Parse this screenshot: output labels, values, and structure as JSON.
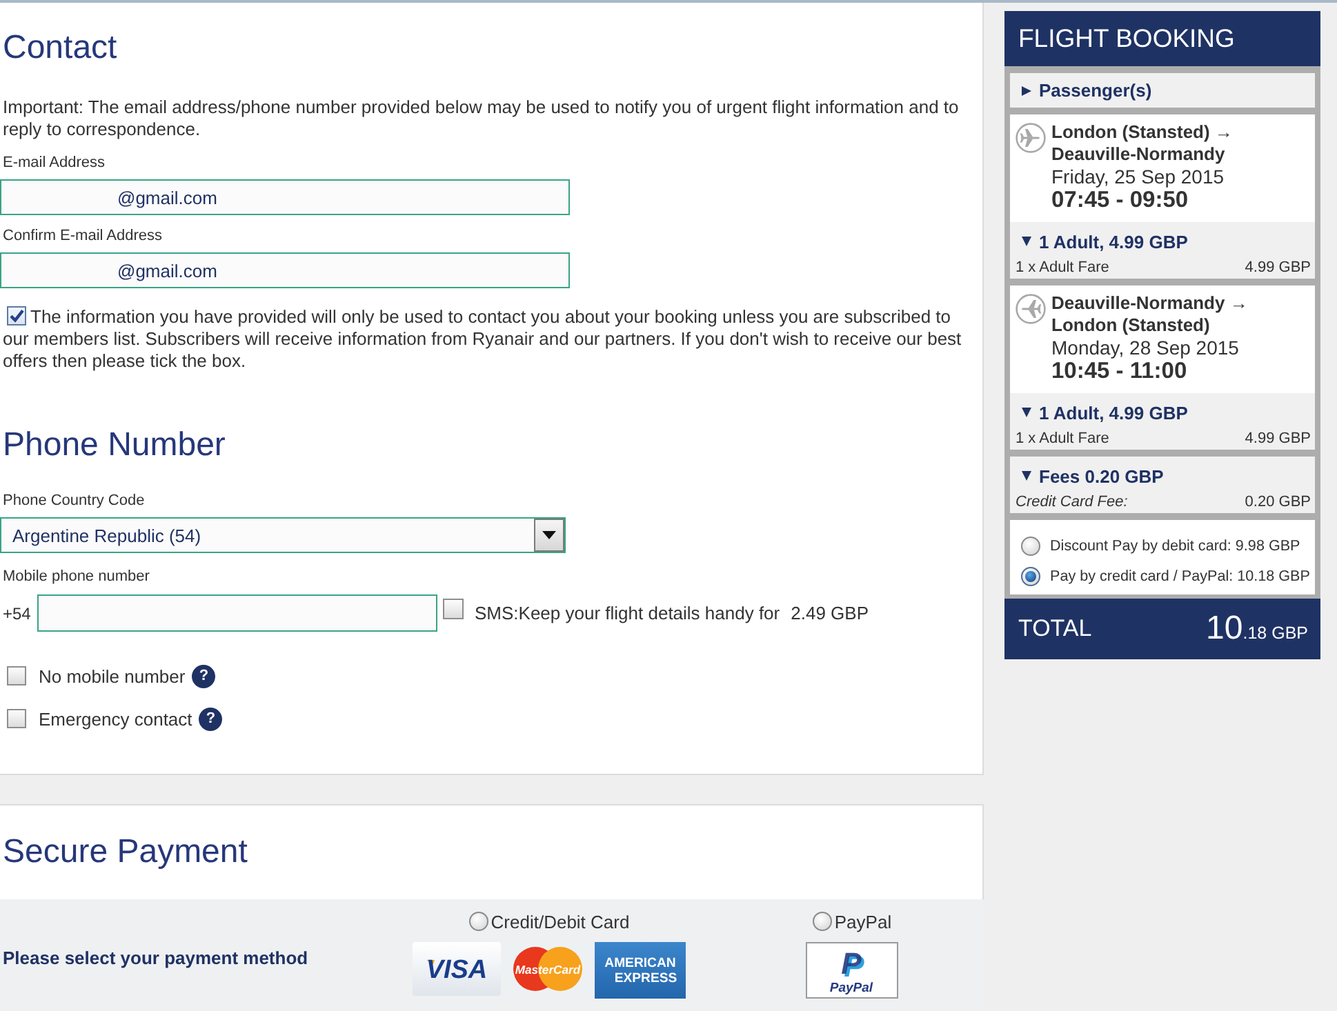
{
  "contact": {
    "title": "Contact",
    "notice": "Important: The email address/phone number provided below may be used to notify you of urgent flight information and to reply to correspondence.",
    "fields": [
      {
        "label": "E-mail Address",
        "value": "@gmail.com"
      },
      {
        "label": "Confirm E-mail Address",
        "value": "@gmail.com"
      }
    ],
    "consent": {
      "checked": true,
      "text": "The information you have provided will only be used to contact you about your booking unless you are subscribed to our members list. Subscribers will receive information from Ryanair and our partners. If you don't wish to receive our best offers then please tick the box."
    }
  },
  "phone": {
    "title": "Phone Number",
    "country": {
      "label": "Phone Country Code",
      "value": "Argentine Republic (54)"
    },
    "mobile": {
      "label": "Mobile phone number",
      "prefix": "+54"
    },
    "sms": {
      "checked": false,
      "text": "SMS:Keep your flight details handy for",
      "price": "2.49 GBP"
    },
    "options": [
      {
        "label": "No mobile number",
        "checked": false,
        "help": "?"
      },
      {
        "label": "Emergency contact",
        "checked": false,
        "help": "?"
      }
    ]
  },
  "payment": {
    "title": "Secure Payment",
    "prompt": "Please select your payment method",
    "methods": [
      {
        "kind": "card",
        "label": "Credit/Debit Card",
        "selected": false,
        "logos": [
          {
            "kind": "visa",
            "text": "VISA"
          },
          {
            "kind": "mastercard",
            "text": "MasterCard"
          },
          {
            "kind": "amex",
            "lines": [
              "AMERICAN",
              "EXPRESS"
            ]
          }
        ]
      },
      {
        "kind": "paypal",
        "label": "PayPal",
        "selected": false,
        "logos": [
          {
            "kind": "paypal",
            "mark": "P",
            "text": "PayPal"
          }
        ]
      }
    ]
  },
  "booking": {
    "title": "FLIGHT BOOKING",
    "passengers": {
      "label": "Passenger(s)",
      "expanded": false
    },
    "flights": [
      {
        "origin": "London (Stansted) →",
        "destination": "Deauville-Normandy",
        "date": "Friday, 25 Sep 2015",
        "times": "07:45 - 09:50",
        "fare": {
          "summary": "1 Adult, 4.99 GBP",
          "expanded": true,
          "lines": [
            {
              "label": "1 x Adult Fare",
              "amount": "4.99 GBP"
            }
          ]
        }
      },
      {
        "origin": "Deauville-Normandy →",
        "destination": "London (Stansted)",
        "date": "Monday, 28 Sep 2015",
        "times": "10:45 - 11:00",
        "fare": {
          "summary": "1 Adult, 4.99 GBP",
          "expanded": true,
          "lines": [
            {
              "label": "1 x Adult Fare",
              "amount": "4.99 GBP"
            }
          ]
        }
      }
    ],
    "fees": {
      "summary": "Fees 0.20 GBP",
      "expanded": true,
      "lines": [
        {
          "label": "Credit Card Fee:",
          "amount": "0.20 GBP"
        }
      ]
    },
    "price_options": [
      {
        "label": "Discount Pay by debit card: 9.98 GBP",
        "selected": false
      },
      {
        "label": "Pay by credit card / PayPal: 10.18 GBP",
        "selected": true
      }
    ],
    "total": {
      "label": "TOTAL",
      "amount": "10",
      "decimals": ".18",
      "currency": "GBP"
    }
  }
}
